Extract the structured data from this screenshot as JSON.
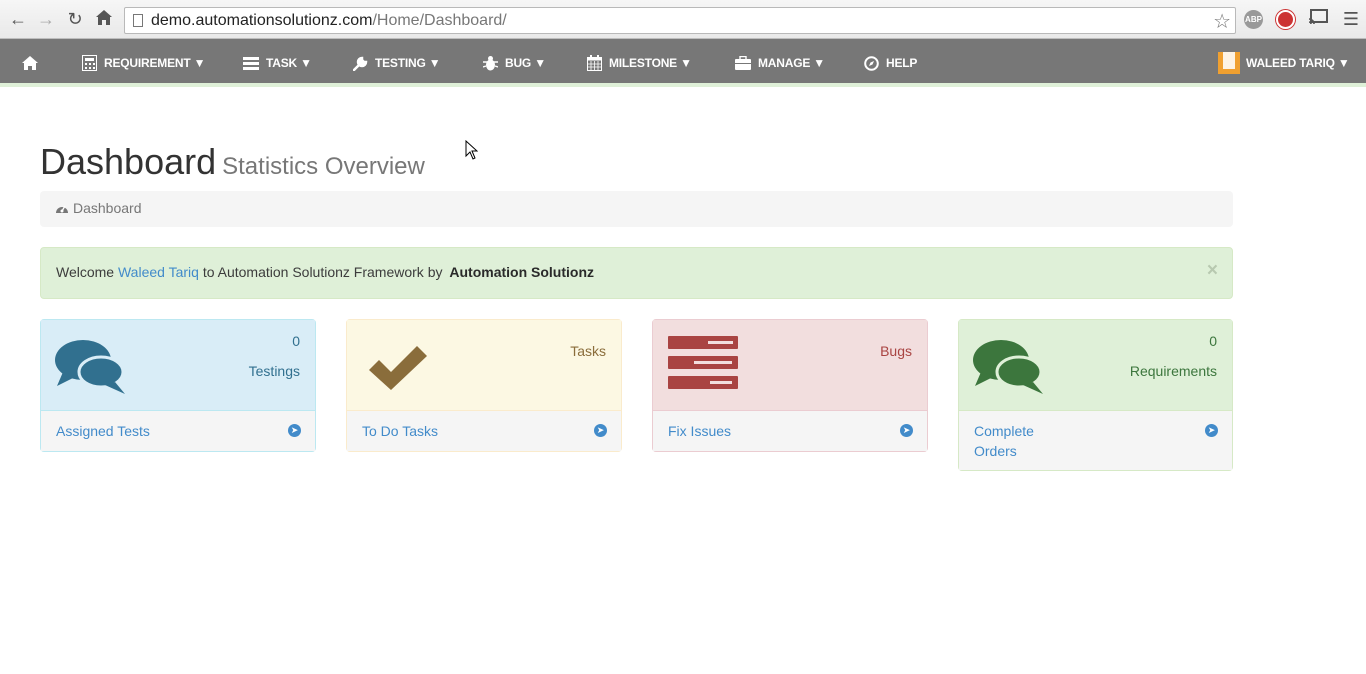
{
  "browser": {
    "url_host": "demo.automationsolutionz.com",
    "url_path": "/Home/Dashboard/",
    "ext_abp": "ABP"
  },
  "navbar": {
    "items": [
      {
        "label": "REQUIREMENT ▼",
        "icon": "calculator-icon"
      },
      {
        "label": "TASK ▼",
        "icon": "list-icon"
      },
      {
        "label": "TESTING ▼",
        "icon": "wrench-icon"
      },
      {
        "label": "BUG ▼",
        "icon": "bug-icon"
      },
      {
        "label": "MILESTONE  ▼",
        "icon": "calendar-icon"
      },
      {
        "label": "MANAGE ▼",
        "icon": "briefcase-icon"
      },
      {
        "label": "HELP",
        "icon": "compass-icon"
      }
    ],
    "user": "WALEED TARIQ ▼"
  },
  "header": {
    "title": "Dashboard",
    "subtitle": "Statistics Overview"
  },
  "breadcrumb": {
    "label": "Dashboard"
  },
  "alert": {
    "prefix": "Welcome",
    "user": "Waleed Tariq",
    "middle": "to Automation Solutionz Framework by",
    "brand": "Automation Solutionz",
    "close": "×"
  },
  "panels": [
    {
      "count": "0",
      "label": "Testings",
      "link": "Assigned Tests",
      "icon": "comments-icon",
      "color": "#31708f"
    },
    {
      "count": "",
      "label": "Tasks",
      "link": "To Do Tasks",
      "icon": "check-icon",
      "color": "#8a6d3b"
    },
    {
      "count": "",
      "label": "Bugs",
      "link": "Fix Issues",
      "icon": "tasks-icon",
      "color": "#a94442"
    },
    {
      "count": "0",
      "label": "Requirements",
      "link_line1": "Complete",
      "link_line2": "Orders",
      "icon": "comments-icon",
      "color": "#3c763d"
    }
  ]
}
